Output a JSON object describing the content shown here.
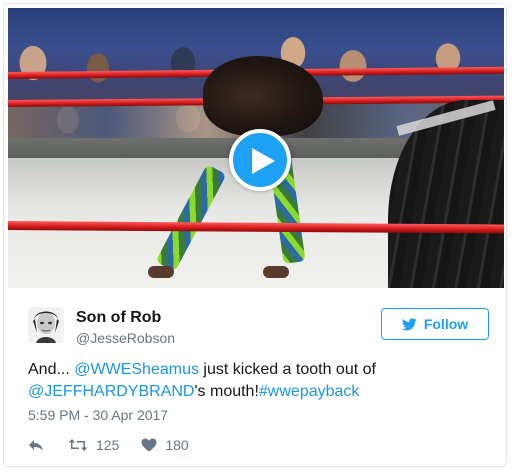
{
  "tweet": {
    "display_name": "Son of Rob",
    "handle": "@JesseRobson",
    "follow_label": "Follow",
    "text": {
      "prefix": "And... ",
      "mention_1": "@WWESheamus",
      "middle": " just kicked a tooth out of ",
      "mention_2": "@JEFFHARDYBRAND",
      "suffix": "'s mouth!",
      "hashtag": "#wwepayback"
    },
    "timestamp": "5:59 PM - 30 Apr 2017",
    "retweet_count": "125",
    "like_count": "180"
  },
  "media": {
    "type": "video",
    "play_icon": "play-icon"
  },
  "colors": {
    "accent": "#1da1f2",
    "link": "#1b95e0",
    "muted": "#657786",
    "text": "#14171a"
  },
  "icons": [
    "play-icon",
    "bird-icon",
    "reply-icon",
    "retweet-icon",
    "heart-icon"
  ]
}
